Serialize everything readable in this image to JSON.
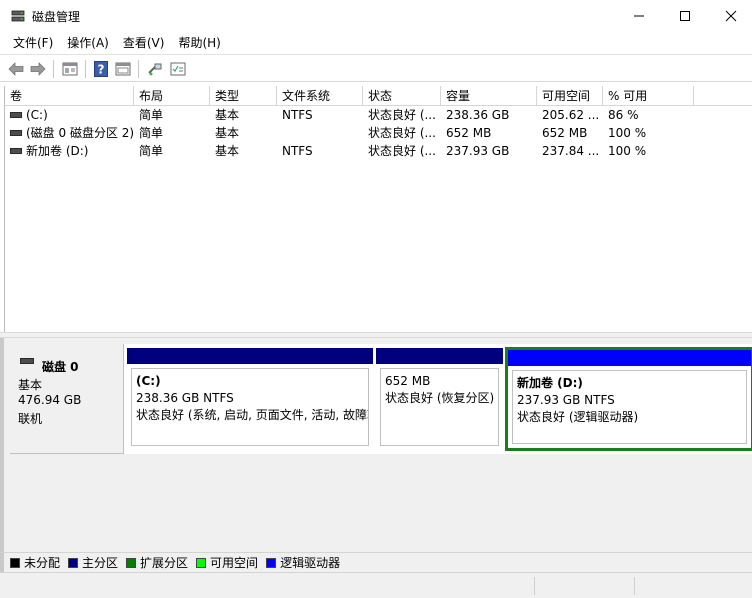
{
  "window": {
    "title": "磁盘管理"
  },
  "menu": [
    {
      "label": "文件(F)"
    },
    {
      "label": "操作(A)"
    },
    {
      "label": "查看(V)"
    },
    {
      "label": "帮助(H)"
    }
  ],
  "volume_list": {
    "columns": [
      "卷",
      "布局",
      "类型",
      "文件系统",
      "状态",
      "容量",
      "可用空间",
      "% 可用"
    ],
    "rows": [
      {
        "volume": "(C:)",
        "layout": "简单",
        "type": "基本",
        "fs": "NTFS",
        "status": "状态良好 (...",
        "capacity": "238.36 GB",
        "free": "205.62 ...",
        "pct": "86 %"
      },
      {
        "volume": "(磁盘 0 磁盘分区 2)",
        "layout": "简单",
        "type": "基本",
        "fs": "",
        "status": "状态良好 (...",
        "capacity": "652 MB",
        "free": "652 MB",
        "pct": "100 %"
      },
      {
        "volume": "新加卷 (D:)",
        "layout": "简单",
        "type": "基本",
        "fs": "NTFS",
        "status": "状态良好 (...",
        "capacity": "237.93 GB",
        "free": "237.84 ...",
        "pct": "100 %"
      }
    ]
  },
  "disk": {
    "name": "磁盘 0",
    "type": "基本",
    "size": "476.94 GB",
    "state": "联机",
    "partitions": [
      {
        "name": "(C:)",
        "size_fs": "238.36 GB NTFS",
        "status": "状态良好 (系统, 启动, 页面文件, 活动, 故障转"
      },
      {
        "name": "",
        "size_fs": "652 MB",
        "status": "状态良好 (恢复分区)"
      },
      {
        "name": "新加卷  (D:)",
        "size_fs": "237.93 GB NTFS",
        "status": "状态良好 (逻辑驱动器)"
      }
    ]
  },
  "legend": [
    {
      "label": "未分配",
      "color": "#000000"
    },
    {
      "label": "主分区",
      "color": "#00007f"
    },
    {
      "label": "扩展分区",
      "color": "#008000"
    },
    {
      "label": "可用空间",
      "color": "#00ff00"
    },
    {
      "label": "逻辑驱动器",
      "color": "#0000ff"
    }
  ],
  "colors": {
    "primary": "#00007f",
    "logical": "#0000ff",
    "selection": "#1b7d1b"
  },
  "icons": [
    "disk-mgmt-app-icon",
    "back-arrow-icon",
    "forward-arrow-icon",
    "console-tree-icon",
    "help-icon",
    "properties-icon",
    "rescan-icon",
    "list-view-icon"
  ]
}
